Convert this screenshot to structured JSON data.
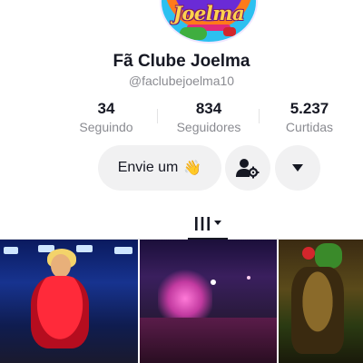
{
  "profile": {
    "avatar_text": "Joelma",
    "display_name": "Fã Clube Joelma",
    "handle": "@faclubejoelma10"
  },
  "stats": [
    {
      "value": "34",
      "label": "Seguindo"
    },
    {
      "value": "834",
      "label": "Seguidores"
    },
    {
      "value": "5.237",
      "label": "Curtidas"
    }
  ],
  "actions": {
    "message_label": "Envie um",
    "message_emoji": "👋",
    "suggest_icon": "person-gear-icon",
    "more_icon": "caret-down-icon"
  },
  "tabs": {
    "active": "videos-grid-icon"
  },
  "videos": [
    {
      "thumbnail": "concert-red-dress"
    },
    {
      "thumbnail": "stage-crowd"
    },
    {
      "thumbnail": "costumed-dancer"
    }
  ]
}
